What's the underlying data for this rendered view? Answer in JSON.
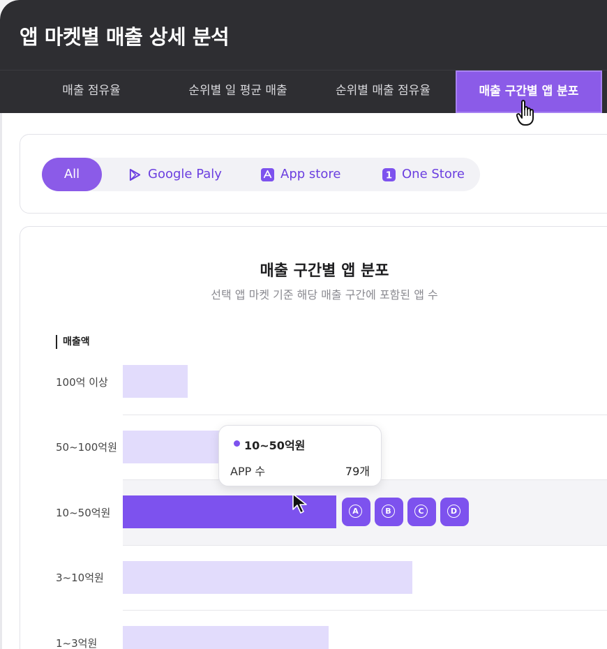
{
  "header": {
    "title": "앱 마켓별 매출 상세 분석"
  },
  "tabs": [
    {
      "label": "매출 점유율"
    },
    {
      "label": "순위별 일 평균 매출"
    },
    {
      "label": "순위별 매출 점유율"
    },
    {
      "label": "매출 구간별 앱 분포",
      "active": true
    }
  ],
  "filters": {
    "all": "All",
    "google": "Google Paly",
    "appstore": "App store",
    "onestore": "One Store",
    "onestore_icon_text": "1"
  },
  "chart": {
    "title": "매출 구간별 앱 분포",
    "subtitle": "선택 앱 마켓 기준 해당 매출 구간에 포함된 앱 수"
  },
  "chart_data": {
    "type": "bar",
    "orientation": "horizontal",
    "title": "매출 구간별 앱 분포",
    "subtitle": "선택 앱 마켓 기준 해당 매출 구간에 포함된 앱 수",
    "ylabel": "매출액",
    "categories": [
      "100억 이상",
      "50~100억원",
      "10~50억원",
      "3~10억원",
      "1~3억원"
    ],
    "values": [
      24,
      38,
      79,
      107,
      76
    ],
    "xlim": [
      0,
      179
    ],
    "highlighted": "10~50억원",
    "highlight_badges": [
      "A",
      "B",
      "C",
      "D"
    ]
  },
  "tooltip": {
    "name": "10~50억원",
    "key": "APP 수",
    "value": "79개"
  },
  "colors": {
    "accent": "#8b5be8",
    "bar": "#e2dcfc",
    "bar_highlight": "#7d52ee",
    "header": "#2e2e32"
  },
  "icons": {
    "cursor_hand": "pointer-hand-icon",
    "cursor_arrow": "arrow-cursor-icon"
  }
}
